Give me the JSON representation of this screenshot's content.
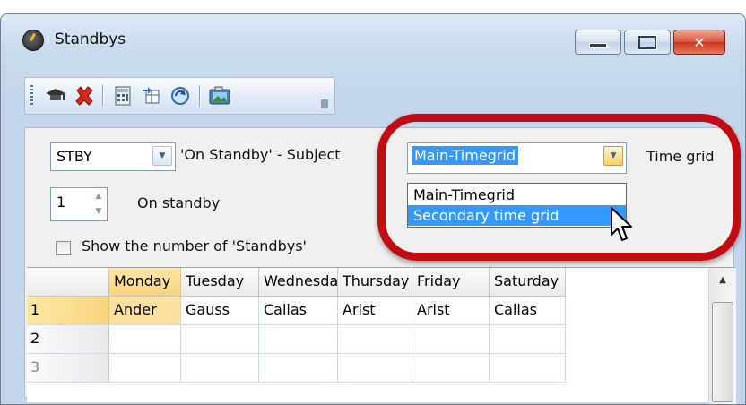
{
  "window": {
    "title": "Standbys",
    "icon": "clock-icon",
    "buttons": {
      "minimize": "minimize-icon",
      "maximize": "maximize-icon",
      "close": "close-icon"
    }
  },
  "toolbar": {
    "icons": [
      "graduation-cap-icon",
      "delete-icon",
      "calculator-icon",
      "table-transfer-icon",
      "refresh-icon",
      "image-icon"
    ]
  },
  "form": {
    "subject_value": "STBY",
    "subject_label": "'On Standby' - Subject",
    "on_standby_value": "1",
    "on_standby_label": "On standby",
    "show_count_label": "Show the number of 'Standbys'",
    "show_count_checked": false,
    "timegrid_value": "Main-Timegrid",
    "timegrid_label": "Time grid",
    "timegrid_options": [
      "Main-Timegrid",
      "Secondary time grid"
    ],
    "timegrid_highlighted": "Secondary time grid"
  },
  "grid": {
    "columns": [
      "Monday",
      "Tuesday",
      "Wednesday",
      "Thursday",
      "Friday",
      "Saturday"
    ],
    "rows": [
      {
        "label": "1",
        "cells": [
          "Ander",
          "Gauss",
          "Callas",
          "Arist",
          "Arist",
          "Callas"
        ]
      },
      {
        "label": "2",
        "cells": [
          "",
          "",
          "",
          "",
          "",
          ""
        ]
      },
      {
        "label": "3",
        "cells": [
          "",
          "",
          "",
          "",
          "",
          ""
        ]
      }
    ]
  },
  "colors": {
    "highlight": "#3399ff",
    "annotation_ring": "#c10d12",
    "selected_cell": "#fbe1a0"
  }
}
